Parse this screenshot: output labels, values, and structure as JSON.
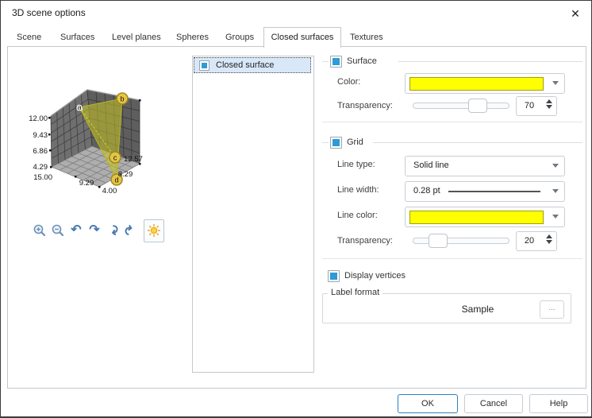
{
  "window": {
    "title": "3D scene options",
    "close_glyph": "✕"
  },
  "tabs": [
    {
      "label": "Scene"
    },
    {
      "label": "Surfaces"
    },
    {
      "label": "Level planes"
    },
    {
      "label": "Spheres"
    },
    {
      "label": "Groups"
    },
    {
      "label": "Closed surfaces"
    },
    {
      "label": "Textures"
    }
  ],
  "active_tab": "Closed surfaces",
  "preview": {
    "vertex_labels": {
      "a": "a",
      "b": "b",
      "c": "c",
      "d": "d"
    },
    "z_ticks": [
      "12.00",
      "9.43",
      "6.86",
      "4.29"
    ],
    "x_ticks": [
      "15.00",
      "9.29",
      "4.00"
    ],
    "y_ticks": [
      "12.57",
      "8.29"
    ],
    "toolbar_icons": [
      "zoom-in",
      "zoom-out",
      "rotate-left",
      "rotate-right",
      "rotate-forward",
      "rotate-backward",
      "light"
    ]
  },
  "list": {
    "items": [
      {
        "label": "Closed surface",
        "checked": true,
        "selected": true
      }
    ]
  },
  "surface_section": {
    "label": "Surface",
    "checked": true,
    "color_label": "Color:",
    "color_value": "#ffff00",
    "transparency_label": "Transparency:",
    "transparency_value": "70"
  },
  "grid_section": {
    "label": "Grid",
    "checked": true,
    "line_type_label": "Line type:",
    "line_type_value": "Solid line",
    "line_width_label": "Line width:",
    "line_width_value": "0.28 pt",
    "line_color_label": "Line color:",
    "line_color_value": "#ffff00",
    "transparency_label": "Transparency:",
    "transparency_value": "20"
  },
  "vertices_section": {
    "label": "Display vertices",
    "checked": true
  },
  "label_format": {
    "title": "Label format",
    "sample_text": "Sample",
    "browse_label": "..."
  },
  "footer": {
    "ok": "OK",
    "cancel": "Cancel",
    "help": "Help"
  },
  "colors": {
    "checkbox_blue": "#2e9bd6",
    "selection_blue": "#d9e8f8",
    "surface_yellow": "#ffff00"
  }
}
